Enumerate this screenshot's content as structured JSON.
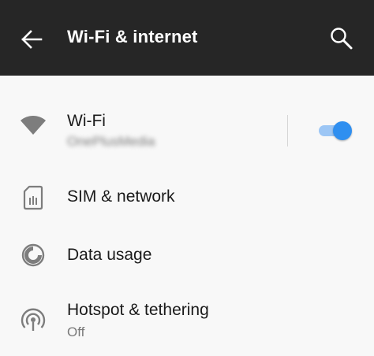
{
  "header": {
    "title": "Wi-Fi & internet",
    "back_icon": "arrow-back-icon",
    "search_icon": "search-icon"
  },
  "rows": [
    {
      "icon": "wifi-icon",
      "label": "Wi-Fi",
      "sub": "OnePlusMedia",
      "toggle_on": true
    },
    {
      "icon": "sim-card-icon",
      "label": "SIM & network"
    },
    {
      "icon": "data-usage-icon",
      "label": "Data usage"
    },
    {
      "icon": "hotspot-icon",
      "label": "Hotspot & tethering",
      "sub": "Off"
    }
  ],
  "colors": {
    "appbar": "#262626",
    "background": "#f8f8f8",
    "accent": "#2f8ff0",
    "accent_track": "#9cc6f5"
  }
}
